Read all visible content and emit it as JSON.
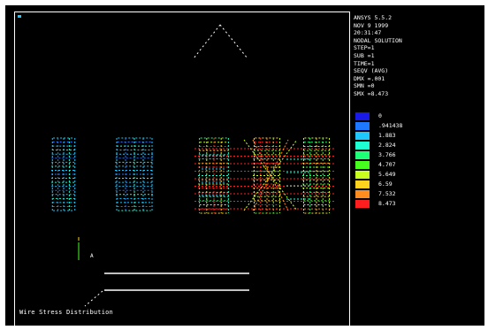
{
  "viewport": {
    "background": "#000000",
    "frame_color": "#ffffff"
  },
  "info_lines": [
    "ANSYS 5.5.2",
    "NOV 9 1999",
    "20:31:47",
    "NODAL SOLUTION",
    "STEP=1",
    "SUB =1",
    "TIME=1",
    "SEQV (AVG)",
    "DMX =.001",
    "SMN =0",
    "SMX =8.473"
  ],
  "legend": {
    "bands": [
      {
        "value": "0",
        "color": "#1a1ae6"
      },
      {
        "value": ".941438",
        "color": "#1e78ff"
      },
      {
        "value": "1.883",
        "color": "#1ec8ff"
      },
      {
        "value": "2.824",
        "color": "#1effd2"
      },
      {
        "value": "3.766",
        "color": "#1eff78"
      },
      {
        "value": "4.707",
        "color": "#46ff1e"
      },
      {
        "value": "5.649",
        "color": "#c8ff1e"
      },
      {
        "value": "6.59",
        "color": "#ffd21e"
      },
      {
        "value": "7.532",
        "color": "#ff8c1e"
      },
      {
        "value": "8.473",
        "color": "#ff1e1e"
      }
    ]
  },
  "caption": "Wire Stress Distribution"
}
